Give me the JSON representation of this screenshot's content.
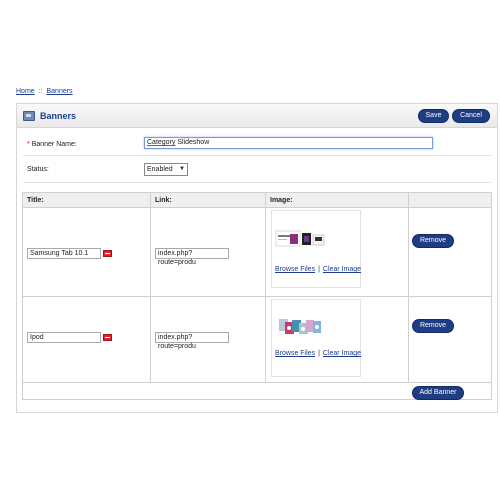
{
  "breadcrumb": {
    "home": "Home",
    "separator": "::",
    "current": "Banners"
  },
  "panel": {
    "title": "Banners",
    "save_label": "Save",
    "cancel_label": "Cancel",
    "icon": "banner-icon"
  },
  "form": {
    "banner_name_label": "Banner Name:",
    "banner_name_value_first": "Category",
    "banner_name_value_rest": " Slideshow",
    "status_label": "Status:",
    "status_value": "Enabled"
  },
  "table": {
    "headers": [
      "Title:",
      "Link:",
      "Image:"
    ],
    "rows": [
      {
        "title": "Samsung Tab 10.1",
        "link": "index.php?route=produ",
        "browse": "Browse Files",
        "separator": "|",
        "clear": "Clear Image",
        "remove": "Remove"
      },
      {
        "title": "Ipod",
        "link": "index.php?route=produ",
        "browse": "Browse Files",
        "separator": "|",
        "clear": "Clear Image",
        "remove": "Remove"
      }
    ],
    "add_label": "Add Banner"
  },
  "colors": {
    "accent": "#1f3d84",
    "link": "#1e3d8f",
    "required": "#cc0000"
  }
}
